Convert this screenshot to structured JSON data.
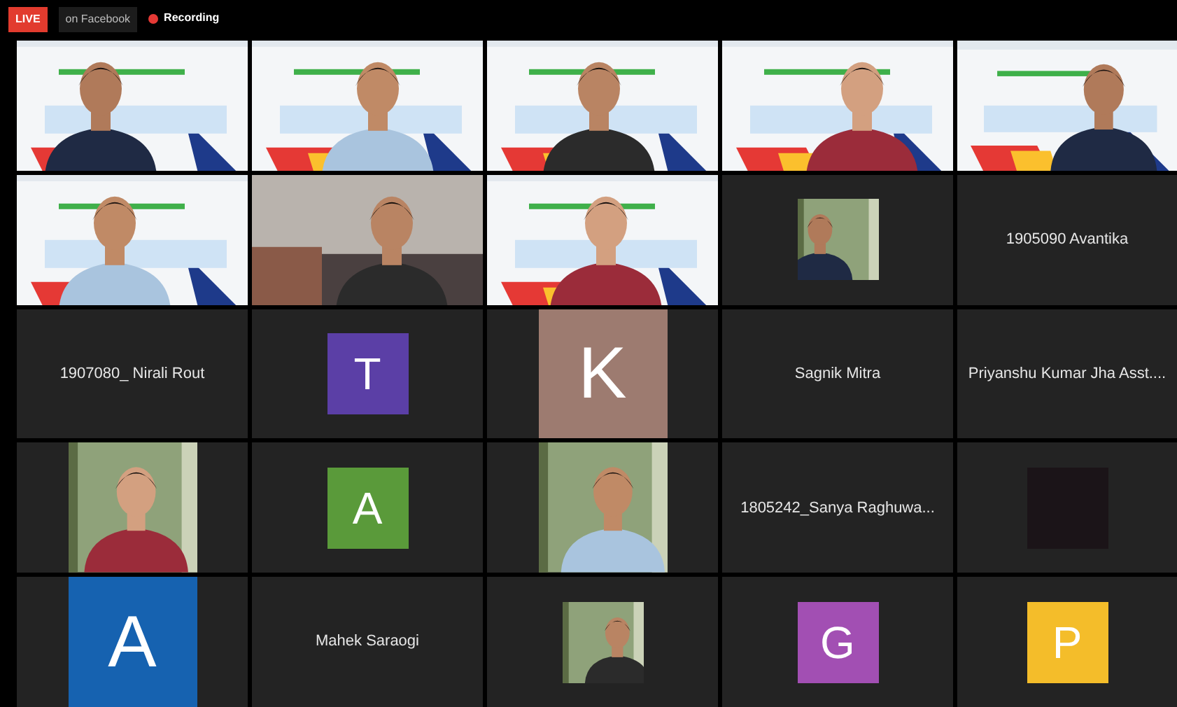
{
  "top_bar": {
    "live_badge": "LIVE",
    "stream_target": "on Facebook",
    "recording": {
      "on": true,
      "label": "Recording"
    }
  },
  "tiles": [
    {
      "kind": "video"
    },
    {
      "kind": "video"
    },
    {
      "kind": "video"
    },
    {
      "kind": "video"
    },
    {
      "kind": "video"
    },
    {
      "kind": "video"
    },
    {
      "kind": "video"
    },
    {
      "kind": "video"
    },
    {
      "kind": "thumbnail"
    },
    {
      "kind": "name",
      "name": "1905090 Avantika"
    },
    {
      "kind": "name",
      "name": "1907080_ Nirali Rout"
    },
    {
      "kind": "initial",
      "letter": "T",
      "color": "#5b3fa6"
    },
    {
      "kind": "block",
      "letter": "K",
      "color": "#9d7b70"
    },
    {
      "kind": "name",
      "name": "Sagnik Mitra"
    },
    {
      "kind": "name",
      "name": "Priyanshu Kumar Jha Asst...."
    },
    {
      "kind": "portrait"
    },
    {
      "kind": "initial",
      "letter": "A",
      "color": "#5a9a3a"
    },
    {
      "kind": "portrait"
    },
    {
      "kind": "name",
      "name": "1805242_Sanya Raghuwa..."
    },
    {
      "kind": "blank"
    },
    {
      "kind": "block",
      "letter": "A",
      "color": "#1662b0"
    },
    {
      "kind": "name",
      "name": "Mahek Saraogi"
    },
    {
      "kind": "thumbnail"
    },
    {
      "kind": "initial",
      "letter": "G",
      "color": "#a24fb3"
    },
    {
      "kind": "initial",
      "letter": "P",
      "color": "#f4bd2a"
    }
  ]
}
